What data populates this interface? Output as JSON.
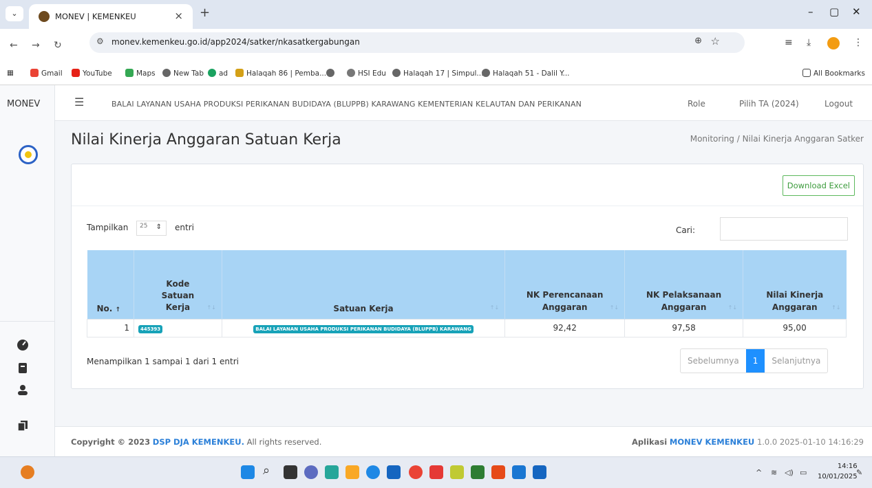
{
  "browser": {
    "tab_title": "MONEV | KEMENKEU",
    "tab_close": "×",
    "new_tab": "+",
    "url": "monev.kemenkeu.go.id/app2024/satker/nkasatkergabungan",
    "bookmarks": [
      "Gmail",
      "YouTube",
      "Maps",
      "New Tab",
      "ad",
      "Halaqah 86 | Pemba...",
      "HSI Edu",
      "Halaqah 17 | Simpul...",
      "Halaqah 51 - Dalil Y..."
    ],
    "all_bookmarks": "All Bookmarks"
  },
  "app": {
    "brand": "MONEV",
    "satker_name": "BALAI LAYANAN USAHA PRODUKSI PERIKANAN BUDIDAYA (BLUPPB) KARAWANG KEMENTERIAN KELAUTAN DAN PERIKANAN",
    "nav": {
      "role": "Role",
      "ta": "Pilih TA (2024)",
      "logout": "Logout"
    },
    "page_title": "Nilai Kinerja Anggaran Satuan Kerja",
    "breadcrumb": {
      "root": "Monitoring",
      "sep": "/",
      "current": "Nilai Kinerja Anggaran Satker"
    },
    "download_label": "Download Excel",
    "length": {
      "prefix": "Tampilkan",
      "value": "25",
      "suffix": "entri"
    },
    "search_label": "Cari:",
    "columns": [
      "No.",
      "Kode Satuan Kerja",
      "Satuan Kerja",
      "NK Perencanaan Anggaran",
      "NK Pelaksanaan Anggaran",
      "Nilai Kinerja Anggaran"
    ],
    "rows": [
      {
        "no": "1",
        "kode": "445393",
        "satker": "BALAI LAYANAN USAHA PRODUKSI PERIKANAN BUDIDAYA (BLUPPB) KARAWANG",
        "nk_perencanaan": "92,42",
        "nk_pelaksanaan": "97,58",
        "nilai_kinerja": "95,00"
      }
    ],
    "info": "Menampilkan 1 sampai 1 dari 1 entri",
    "pager": {
      "prev": "Sebelumnya",
      "page": "1",
      "next": "Selanjutnya"
    },
    "footer": {
      "copyright_prefix": "Copyright © 2023",
      "org": "DSP DJA KEMENKEU.",
      "rights": "All rights reserved.",
      "app_prefix": "Aplikasi",
      "app_name": "MONEV KEMENKEU",
      "version": "1.0.0 2025-01-10 14:16:29"
    }
  },
  "taskbar": {
    "time": "14:16",
    "date": "10/01/2025"
  },
  "colors": {
    "table_header": "#a8d4f5",
    "badge": "#17a2b8",
    "primary": "#1e90ff",
    "excel_green": "#5cb85c"
  }
}
